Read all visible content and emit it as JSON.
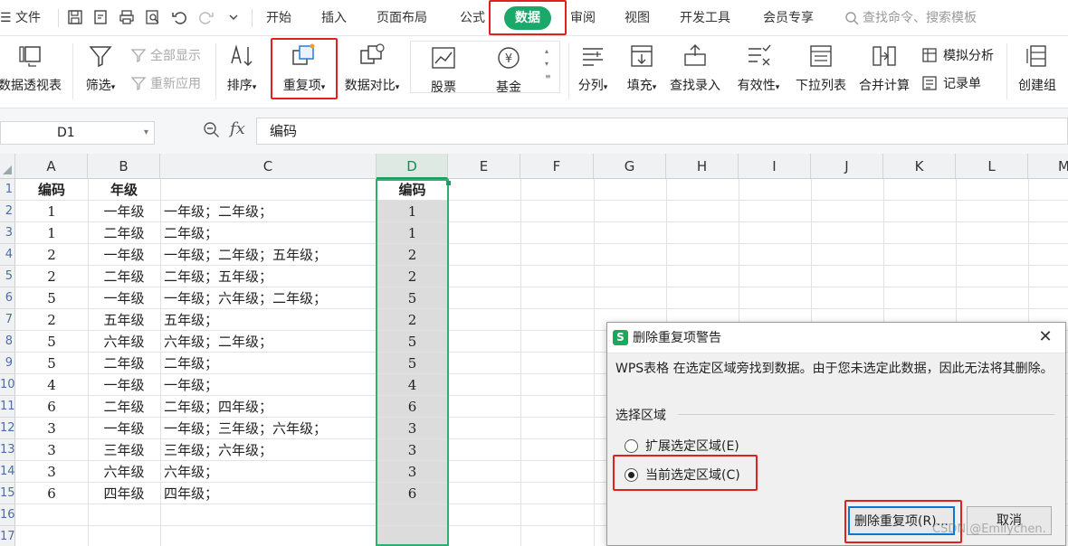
{
  "menubar": {
    "file_label": "文件",
    "tabs": [
      "开始",
      "插入",
      "页面布局",
      "公式",
      "数据",
      "审阅",
      "视图",
      "开发工具",
      "会员专享"
    ],
    "active_tab": "数据",
    "search_placeholder": "查找命令、搜索模板",
    "accent_color": "#1aa86b"
  },
  "ribbon": {
    "pivot": "数据透视表",
    "filter": "筛选",
    "show_all": "全部显示",
    "reapply": "重新应用",
    "sort": "排序",
    "duplicates": "重复项",
    "compare": "数据对比",
    "stocks": "股票",
    "funds": "基金",
    "split": "分列",
    "fill": "填充",
    "lookup_entry": "查找录入",
    "validity": "有效性",
    "dropdown_list": "下拉列表",
    "consolidate": "合并计算",
    "what_if": "模拟分析",
    "record_form": "记录单",
    "create_group": "创建组"
  },
  "formula_bar": {
    "cell_ref": "D1",
    "fx_label": "fx",
    "content": "编码"
  },
  "sheet": {
    "columns": [
      "A",
      "B",
      "C",
      "D",
      "E",
      "F",
      "G",
      "H",
      "I",
      "J",
      "K",
      "L",
      "M"
    ],
    "selected_column": "D",
    "row_numbers": [
      "1",
      "2",
      "3",
      "4",
      "5",
      "6",
      "7",
      "8",
      "9",
      "10",
      "11",
      "12",
      "13",
      "14",
      "15",
      "16",
      "17"
    ],
    "header": {
      "a": "编码",
      "b": "年级",
      "d": "编码"
    },
    "rows": [
      {
        "a": "1",
        "b": "一年级",
        "c": "一年级；二年级；",
        "d": "1"
      },
      {
        "a": "1",
        "b": "二年级",
        "c": "二年级；",
        "d": "1"
      },
      {
        "a": "2",
        "b": "一年级",
        "c": "一年级；二年级；五年级；",
        "d": "2"
      },
      {
        "a": "2",
        "b": "二年级",
        "c": "二年级；五年级；",
        "d": "2"
      },
      {
        "a": "5",
        "b": "一年级",
        "c": "一年级；六年级；二年级；",
        "d": "5"
      },
      {
        "a": "2",
        "b": "五年级",
        "c": "五年级；",
        "d": "2"
      },
      {
        "a": "5",
        "b": "六年级",
        "c": "六年级；二年级；",
        "d": "5"
      },
      {
        "a": "5",
        "b": "二年级",
        "c": "二年级；",
        "d": "5"
      },
      {
        "a": "4",
        "b": "一年级",
        "c": "一年级；",
        "d": "4"
      },
      {
        "a": "6",
        "b": "二年级",
        "c": "二年级；四年级；",
        "d": "6"
      },
      {
        "a": "3",
        "b": "一年级",
        "c": "一年级；三年级；六年级；",
        "d": "3"
      },
      {
        "a": "3",
        "b": "三年级",
        "c": "三年级；六年级；",
        "d": "3"
      },
      {
        "a": "3",
        "b": "六年级",
        "c": "六年级；",
        "d": "3"
      },
      {
        "a": "6",
        "b": "四年级",
        "c": "四年级；",
        "d": "6"
      }
    ]
  },
  "dialog": {
    "title": "删除重复项警告",
    "app_badge": "S",
    "message": "WPS表格 在选定区域旁找到数据。由于您未选定此数据，因此无法将其删除。",
    "group_label": "选择区域",
    "option_expand": "扩展选定区域(E)",
    "option_current": "当前选定区域(C)",
    "selected_option": "current",
    "remove_button": "删除重复项(R)...",
    "cancel_button": "取消"
  },
  "watermark": "CSDN @Emilychen."
}
